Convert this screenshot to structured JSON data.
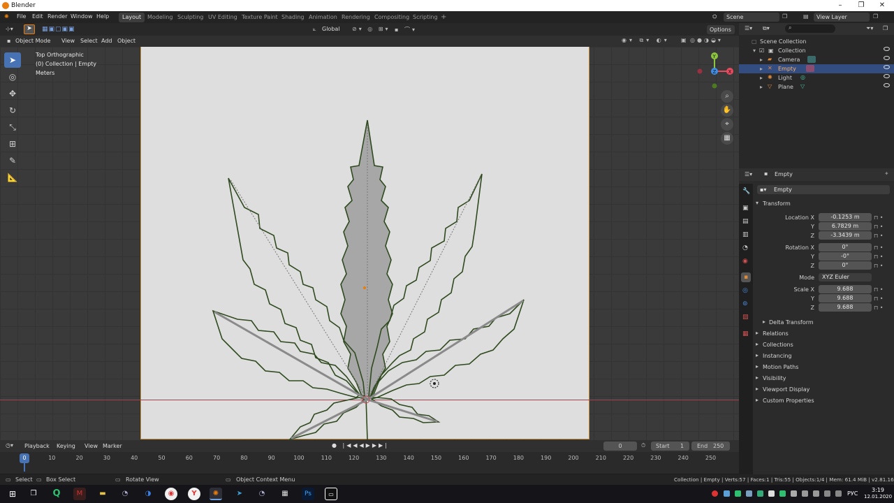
{
  "titlebar": {
    "title": "Blender",
    "minimize": "–",
    "maximize": "❐",
    "close": "✕"
  },
  "menu": {
    "items": [
      "File",
      "Edit",
      "Render",
      "Window",
      "Help"
    ]
  },
  "workspaces": {
    "tabs": [
      "Layout",
      "Modeling",
      "Sculpting",
      "UV Editing",
      "Texture Paint",
      "Shading",
      "Animation",
      "Rendering",
      "Compositing",
      "Scripting"
    ],
    "add": "+",
    "active": "Layout"
  },
  "topright": {
    "scene": "Scene",
    "view_layer": "View Layer"
  },
  "toolheader": {
    "orientation": "Global",
    "options": "Options"
  },
  "viewport_header": {
    "mode": "Object Mode",
    "menus": [
      "View",
      "Select",
      "Add",
      "Object"
    ]
  },
  "overlay_text": {
    "line1": "Top Orthographic",
    "line2": "(0) Collection | Empty",
    "line3": "Meters"
  },
  "gizmo": {
    "y": "Y",
    "z": "Z",
    "x": "X"
  },
  "outliner": {
    "root": "Scene Collection",
    "collection": "Collection",
    "items": [
      {
        "name": "Camera",
        "icon_color": "#e08a3c",
        "selected": false
      },
      {
        "name": "Empty",
        "icon_color": "#e08a3c",
        "selected": true
      },
      {
        "name": "Light",
        "icon_color": "#e08a3c",
        "selected": false
      },
      {
        "name": "Plane",
        "icon_color": "#e08a3c",
        "selected": false
      }
    ]
  },
  "properties": {
    "object_name": "Empty",
    "data_name": "Empty",
    "transform_header": "Transform",
    "location": {
      "label": "Location X",
      "y_label": "Y",
      "z_label": "Z",
      "x": "-0.1253 m",
      "y": "6.7829 m",
      "z": "-3.3439 m"
    },
    "rotation": {
      "label": "Rotation X",
      "y_label": "Y",
      "z_label": "Z",
      "x": "0°",
      "y": "-0°",
      "z": "0°"
    },
    "mode": {
      "label": "Mode",
      "value": "XYZ Euler"
    },
    "scale": {
      "label": "Scale X",
      "y_label": "Y",
      "z_label": "Z",
      "x": "9.688",
      "y": "9.688",
      "z": "9.688"
    },
    "delta": "Delta Transform",
    "sections": [
      "Relations",
      "Collections",
      "Instancing",
      "Motion Paths",
      "Visibility",
      "Viewport Display",
      "Custom Properties"
    ]
  },
  "timeline": {
    "menus": [
      "Playback",
      "Keying",
      "View",
      "Marker"
    ],
    "current_frame": "0",
    "start_label": "Start",
    "start": "1",
    "end_label": "End",
    "end": "250",
    "ruler": [
      "0",
      "10",
      "20",
      "30",
      "40",
      "50",
      "60",
      "70",
      "80",
      "90",
      "100",
      "110",
      "120",
      "130",
      "140",
      "150",
      "160",
      "170",
      "180",
      "190",
      "200",
      "210",
      "220",
      "230",
      "240",
      "250"
    ],
    "playhead": "0"
  },
  "statusbar": {
    "select": "Select",
    "box_select": "Box Select",
    "rotate_view": "Rotate View",
    "context_menu": "Object Context Menu",
    "stats": "Collection | Empty | Verts:57 | Faces:1 | Tris:55 | Objects:1/4 | Mem: 61.4 MiB | v2.81.16"
  },
  "taskbar": {
    "time": "3:19",
    "date": "12.01.2020",
    "lang": "РУС"
  },
  "colors": {
    "accent": "#4772b3",
    "selected_row": "#334d80",
    "x_axis": "#e84a5f",
    "y_axis": "#8cc63f",
    "z_axis": "#3f8fe8",
    "leaf_outline": "#2f4a1f",
    "leaf_fill": "#a7a7a7"
  }
}
